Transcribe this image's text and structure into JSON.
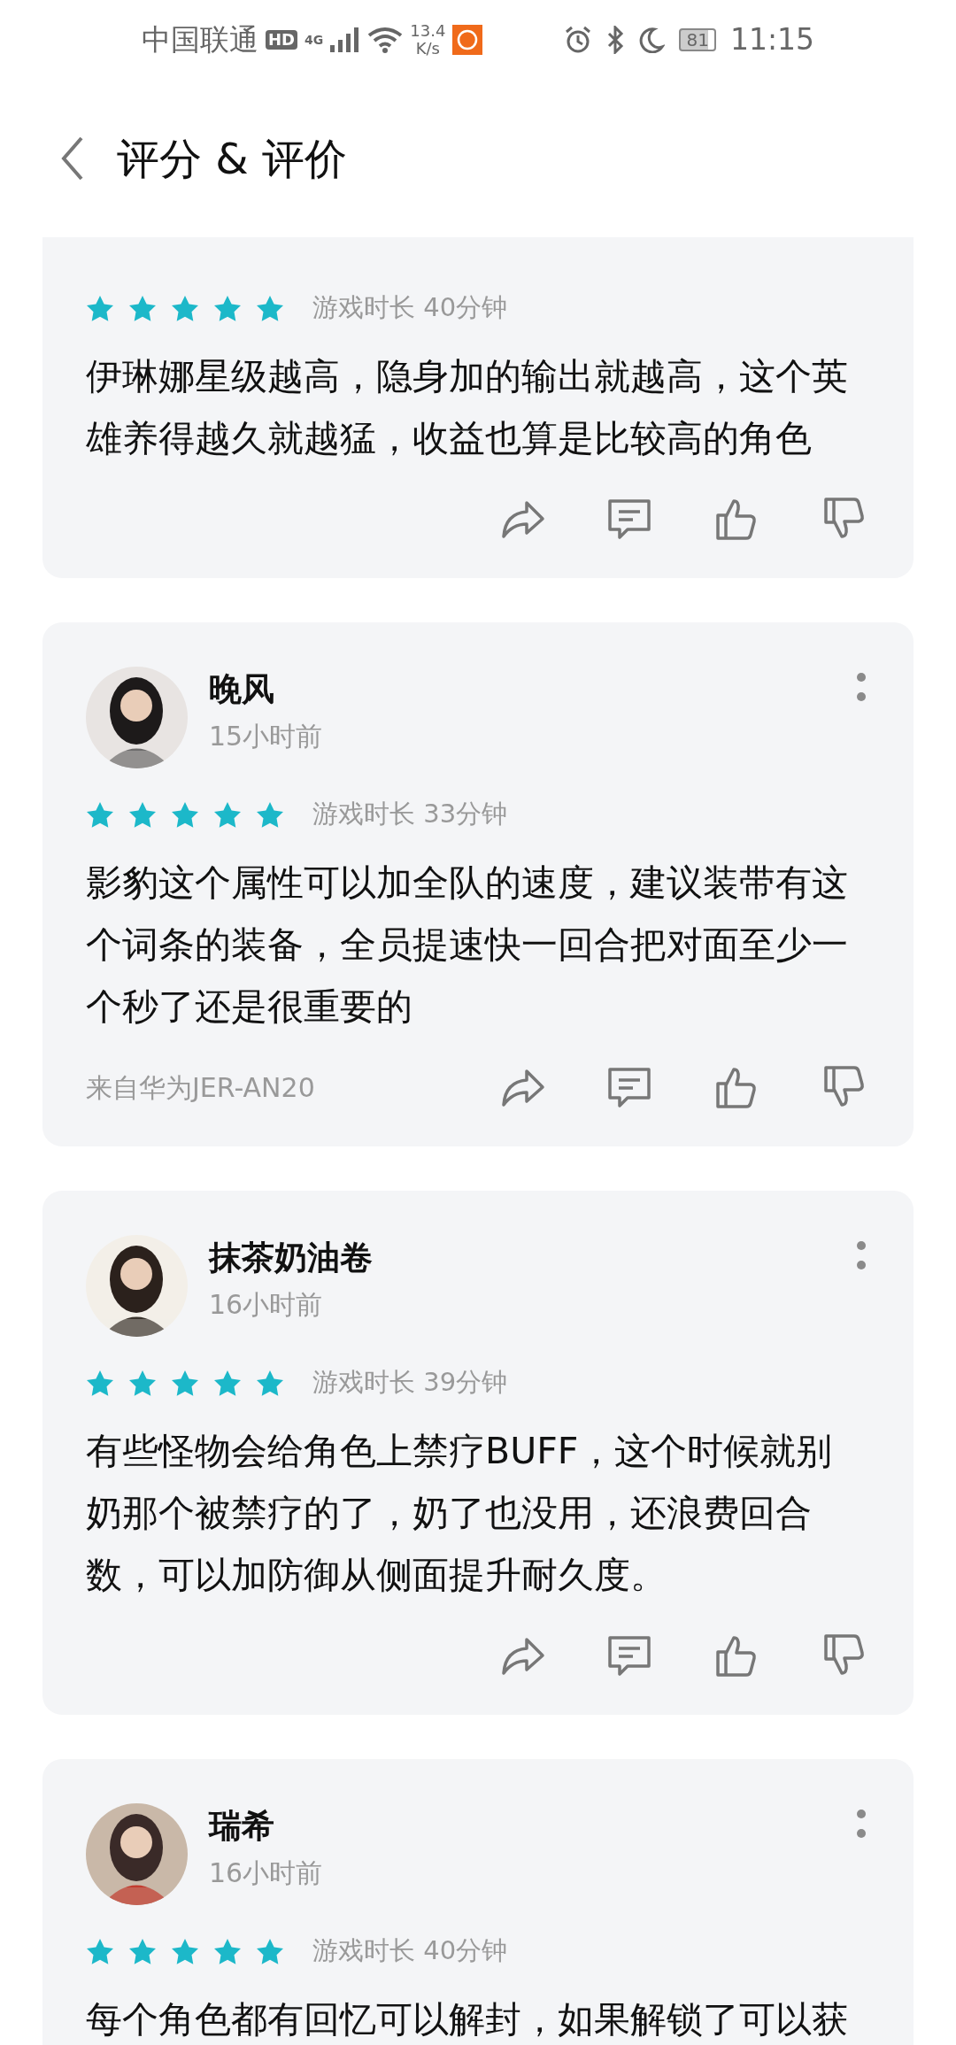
{
  "status_bar": {
    "carrier": "中国联通",
    "hd": "HD",
    "network": "4G",
    "speed_value": "13.4",
    "speed_unit": "K/s",
    "battery": "81",
    "time": "11:15"
  },
  "header": {
    "title": "评分 & 评价"
  },
  "reviews": [
    {
      "stars": 5,
      "playtime": "游戏时长 40分钟",
      "text": "伊琳娜星级越高，隐身加的输出就越高，这个英雄养得越久就越猛，收益也算是比较高的角色"
    },
    {
      "author": "晚风",
      "time": "15小时前",
      "stars": 5,
      "playtime": "游戏时长 33分钟",
      "text": "影豹这个属性可以加全队的速度，建议装带有这个词条的装备，全员提速快一回合把对面至少一个秒了还是很重要的",
      "device": "来自华为JER-AN20"
    },
    {
      "author": "抹茶奶油卷",
      "time": "16小时前",
      "stars": 5,
      "playtime": "游戏时长 39分钟",
      "text": "有些怪物会给角色上禁疗BUFF，这个时候就别奶那个被禁疗的了，奶了也没用，还浪费回合数，可以加防御从侧面提升耐久度。"
    },
    {
      "author": "瑞希",
      "time": "16小时前",
      "stars": 5,
      "playtime": "游戏时长 40分钟",
      "text": "每个角色都有回忆可以解封，如果解锁了可以获"
    }
  ]
}
